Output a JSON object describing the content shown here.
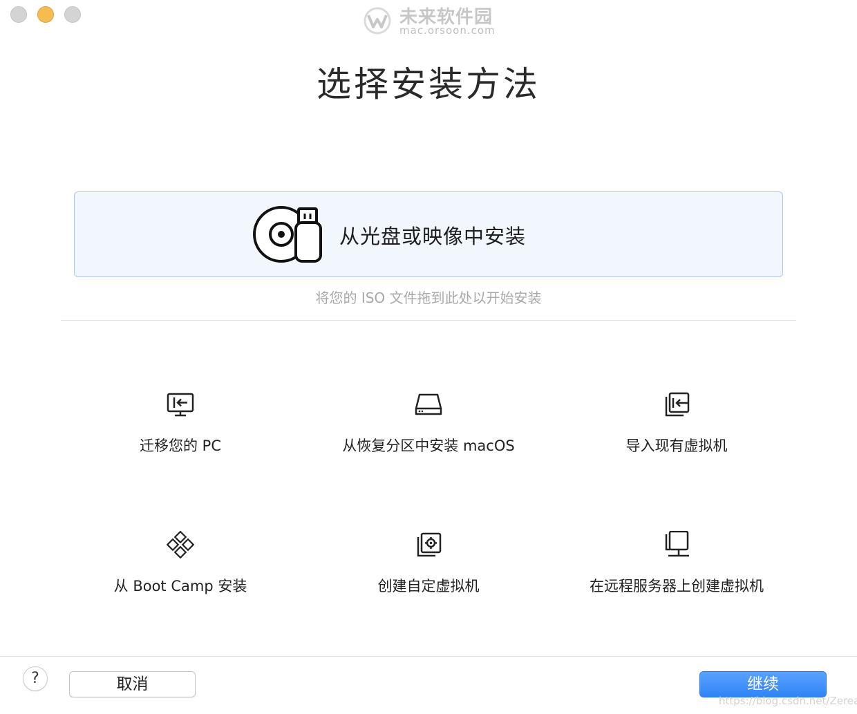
{
  "window": {
    "watermark_cn": "未来软件园",
    "watermark_url": "mac.orsoon.com"
  },
  "title": "选择安装方法",
  "primary_option": {
    "label": "从光盘或映像中安装",
    "icon": "disc-usb-icon"
  },
  "drop_hint": "将您的 ISO 文件拖到此处以开始安装",
  "options": [
    {
      "label": "迁移您的 PC",
      "icon": "migrate-pc-icon"
    },
    {
      "label": "从恢复分区中安装 macOS",
      "icon": "hard-drive-icon"
    },
    {
      "label": "导入现有虚拟机",
      "icon": "import-vm-icon"
    },
    {
      "label": "从 Boot Camp 安装",
      "icon": "boot-camp-icon"
    },
    {
      "label": "创建自定虚拟机",
      "icon": "custom-vm-icon"
    },
    {
      "label": "在远程服务器上创建虚拟机",
      "icon": "remote-server-icon"
    }
  ],
  "footer": {
    "help_label": "?",
    "cancel_label": "取消",
    "continue_label": "继续",
    "source_mark": "https://blog.csdn.net/Zereao"
  },
  "colors": {
    "accent": "#2f84f7",
    "card_border": "#a9c6f0",
    "card_background": "#f2f6fd",
    "traffic_close": "#d4d4d4",
    "traffic_minimize": "#f5bd4f",
    "traffic_zoom": "#d4d4d4"
  }
}
